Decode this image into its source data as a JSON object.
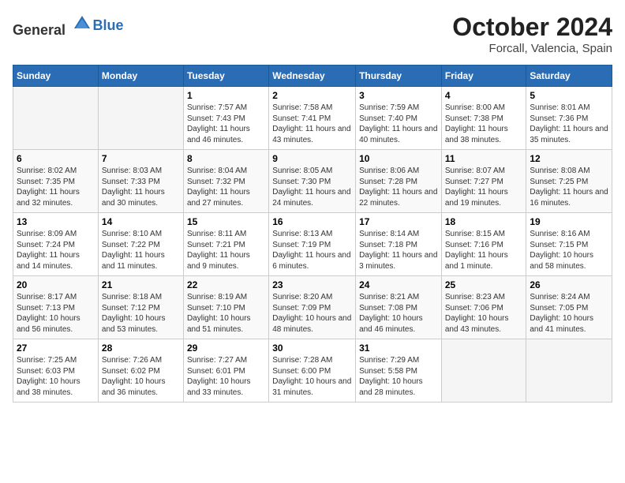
{
  "header": {
    "logo_general": "General",
    "logo_blue": "Blue",
    "title": "October 2024",
    "subtitle": "Forcall, Valencia, Spain"
  },
  "weekdays": [
    "Sunday",
    "Monday",
    "Tuesday",
    "Wednesday",
    "Thursday",
    "Friday",
    "Saturday"
  ],
  "weeks": [
    [
      {
        "day": "",
        "info": ""
      },
      {
        "day": "",
        "info": ""
      },
      {
        "day": "1",
        "info": "Sunrise: 7:57 AM\nSunset: 7:43 PM\nDaylight: 11 hours and 46 minutes."
      },
      {
        "day": "2",
        "info": "Sunrise: 7:58 AM\nSunset: 7:41 PM\nDaylight: 11 hours and 43 minutes."
      },
      {
        "day": "3",
        "info": "Sunrise: 7:59 AM\nSunset: 7:40 PM\nDaylight: 11 hours and 40 minutes."
      },
      {
        "day": "4",
        "info": "Sunrise: 8:00 AM\nSunset: 7:38 PM\nDaylight: 11 hours and 38 minutes."
      },
      {
        "day": "5",
        "info": "Sunrise: 8:01 AM\nSunset: 7:36 PM\nDaylight: 11 hours and 35 minutes."
      }
    ],
    [
      {
        "day": "6",
        "info": "Sunrise: 8:02 AM\nSunset: 7:35 PM\nDaylight: 11 hours and 32 minutes."
      },
      {
        "day": "7",
        "info": "Sunrise: 8:03 AM\nSunset: 7:33 PM\nDaylight: 11 hours and 30 minutes."
      },
      {
        "day": "8",
        "info": "Sunrise: 8:04 AM\nSunset: 7:32 PM\nDaylight: 11 hours and 27 minutes."
      },
      {
        "day": "9",
        "info": "Sunrise: 8:05 AM\nSunset: 7:30 PM\nDaylight: 11 hours and 24 minutes."
      },
      {
        "day": "10",
        "info": "Sunrise: 8:06 AM\nSunset: 7:28 PM\nDaylight: 11 hours and 22 minutes."
      },
      {
        "day": "11",
        "info": "Sunrise: 8:07 AM\nSunset: 7:27 PM\nDaylight: 11 hours and 19 minutes."
      },
      {
        "day": "12",
        "info": "Sunrise: 8:08 AM\nSunset: 7:25 PM\nDaylight: 11 hours and 16 minutes."
      }
    ],
    [
      {
        "day": "13",
        "info": "Sunrise: 8:09 AM\nSunset: 7:24 PM\nDaylight: 11 hours and 14 minutes."
      },
      {
        "day": "14",
        "info": "Sunrise: 8:10 AM\nSunset: 7:22 PM\nDaylight: 11 hours and 11 minutes."
      },
      {
        "day": "15",
        "info": "Sunrise: 8:11 AM\nSunset: 7:21 PM\nDaylight: 11 hours and 9 minutes."
      },
      {
        "day": "16",
        "info": "Sunrise: 8:13 AM\nSunset: 7:19 PM\nDaylight: 11 hours and 6 minutes."
      },
      {
        "day": "17",
        "info": "Sunrise: 8:14 AM\nSunset: 7:18 PM\nDaylight: 11 hours and 3 minutes."
      },
      {
        "day": "18",
        "info": "Sunrise: 8:15 AM\nSunset: 7:16 PM\nDaylight: 11 hours and 1 minute."
      },
      {
        "day": "19",
        "info": "Sunrise: 8:16 AM\nSunset: 7:15 PM\nDaylight: 10 hours and 58 minutes."
      }
    ],
    [
      {
        "day": "20",
        "info": "Sunrise: 8:17 AM\nSunset: 7:13 PM\nDaylight: 10 hours and 56 minutes."
      },
      {
        "day": "21",
        "info": "Sunrise: 8:18 AM\nSunset: 7:12 PM\nDaylight: 10 hours and 53 minutes."
      },
      {
        "day": "22",
        "info": "Sunrise: 8:19 AM\nSunset: 7:10 PM\nDaylight: 10 hours and 51 minutes."
      },
      {
        "day": "23",
        "info": "Sunrise: 8:20 AM\nSunset: 7:09 PM\nDaylight: 10 hours and 48 minutes."
      },
      {
        "day": "24",
        "info": "Sunrise: 8:21 AM\nSunset: 7:08 PM\nDaylight: 10 hours and 46 minutes."
      },
      {
        "day": "25",
        "info": "Sunrise: 8:23 AM\nSunset: 7:06 PM\nDaylight: 10 hours and 43 minutes."
      },
      {
        "day": "26",
        "info": "Sunrise: 8:24 AM\nSunset: 7:05 PM\nDaylight: 10 hours and 41 minutes."
      }
    ],
    [
      {
        "day": "27",
        "info": "Sunrise: 7:25 AM\nSunset: 6:03 PM\nDaylight: 10 hours and 38 minutes."
      },
      {
        "day": "28",
        "info": "Sunrise: 7:26 AM\nSunset: 6:02 PM\nDaylight: 10 hours and 36 minutes."
      },
      {
        "day": "29",
        "info": "Sunrise: 7:27 AM\nSunset: 6:01 PM\nDaylight: 10 hours and 33 minutes."
      },
      {
        "day": "30",
        "info": "Sunrise: 7:28 AM\nSunset: 6:00 PM\nDaylight: 10 hours and 31 minutes."
      },
      {
        "day": "31",
        "info": "Sunrise: 7:29 AM\nSunset: 5:58 PM\nDaylight: 10 hours and 28 minutes."
      },
      {
        "day": "",
        "info": ""
      },
      {
        "day": "",
        "info": ""
      }
    ]
  ]
}
